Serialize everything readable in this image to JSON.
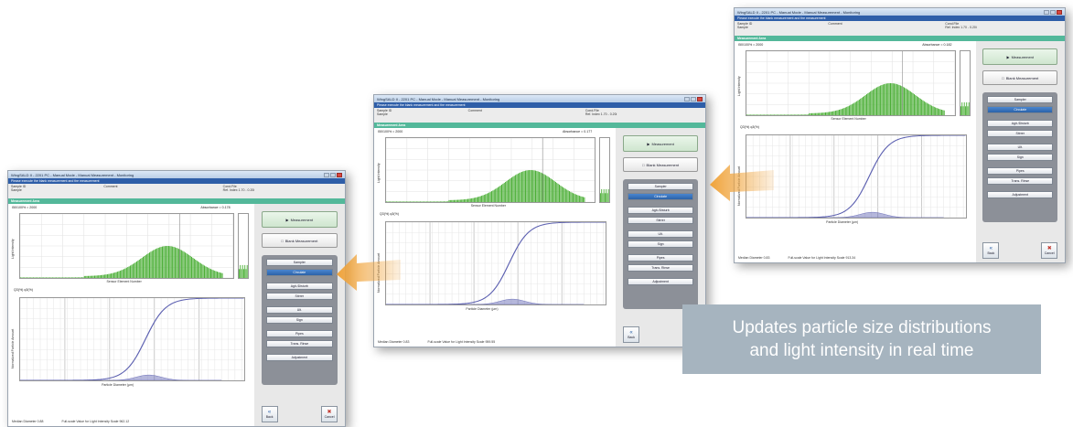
{
  "window": {
    "title": "WingSALD II - 2201 PC - Manual Mode - Manual Measurement - Monitoring",
    "instruction": "Please execute the blank measurement and the measurement",
    "info": {
      "sample_id_label": "Sample ID",
      "sample_label": "Sample",
      "comment_label": "Comment",
      "cond_file_label": "Cond.File",
      "refr_index_label": "Ref. Index",
      "refr_index_value": "1.70 - 0.20i"
    },
    "area_header": "Measurement Area",
    "quantity_label": "Q3(%)  q3(%)",
    "plot_top_axis_x": "Sensor Element Number",
    "plot_top_axis_y": "Light Intensity",
    "plot_bottom_axis_x": "Particle Diameter (μm)",
    "plot_bottom_axis_y": "Normalized Particle Amount",
    "footer": {
      "median_label": "Median Diameter",
      "full_scale_label": "Full-scale Value for Light Intensity Scale"
    },
    "side": {
      "measurement_btn": "Measurement",
      "blank_btn": "Blank Measurement",
      "controls": [
        "Sampler",
        "Circulate",
        "Agit./Disturb",
        "Stirrer",
        "Ult.",
        "Sign",
        "Pipes",
        "Trans. Rinse"
      ],
      "adjustment": "Adjustment",
      "back": "Back",
      "cancel": "Cancel"
    }
  },
  "windows": [
    {
      "scale": "I50/100% = 2000",
      "absorbance": "Absorbance = 0.178",
      "median": "0.88",
      "full_scale": "962.12"
    },
    {
      "scale": "I50/100% = 2000",
      "absorbance": "Absorbance = 0.177",
      "median": "0.83",
      "full_scale": "959.55"
    },
    {
      "scale": "I50/100% = 2000",
      "absorbance": "Absorbance = 0.182",
      "median": "0.83",
      "full_scale": "913.34"
    }
  ],
  "caption": {
    "line1": "Updates particle size distributions",
    "line2": "and light intensity in real time"
  },
  "colors": {
    "accent_arrow": "#f0a33a",
    "bar_green": "#4caf37",
    "curve_blue": "#5b5fb0",
    "caption_bg": "#a6b4bf"
  }
}
